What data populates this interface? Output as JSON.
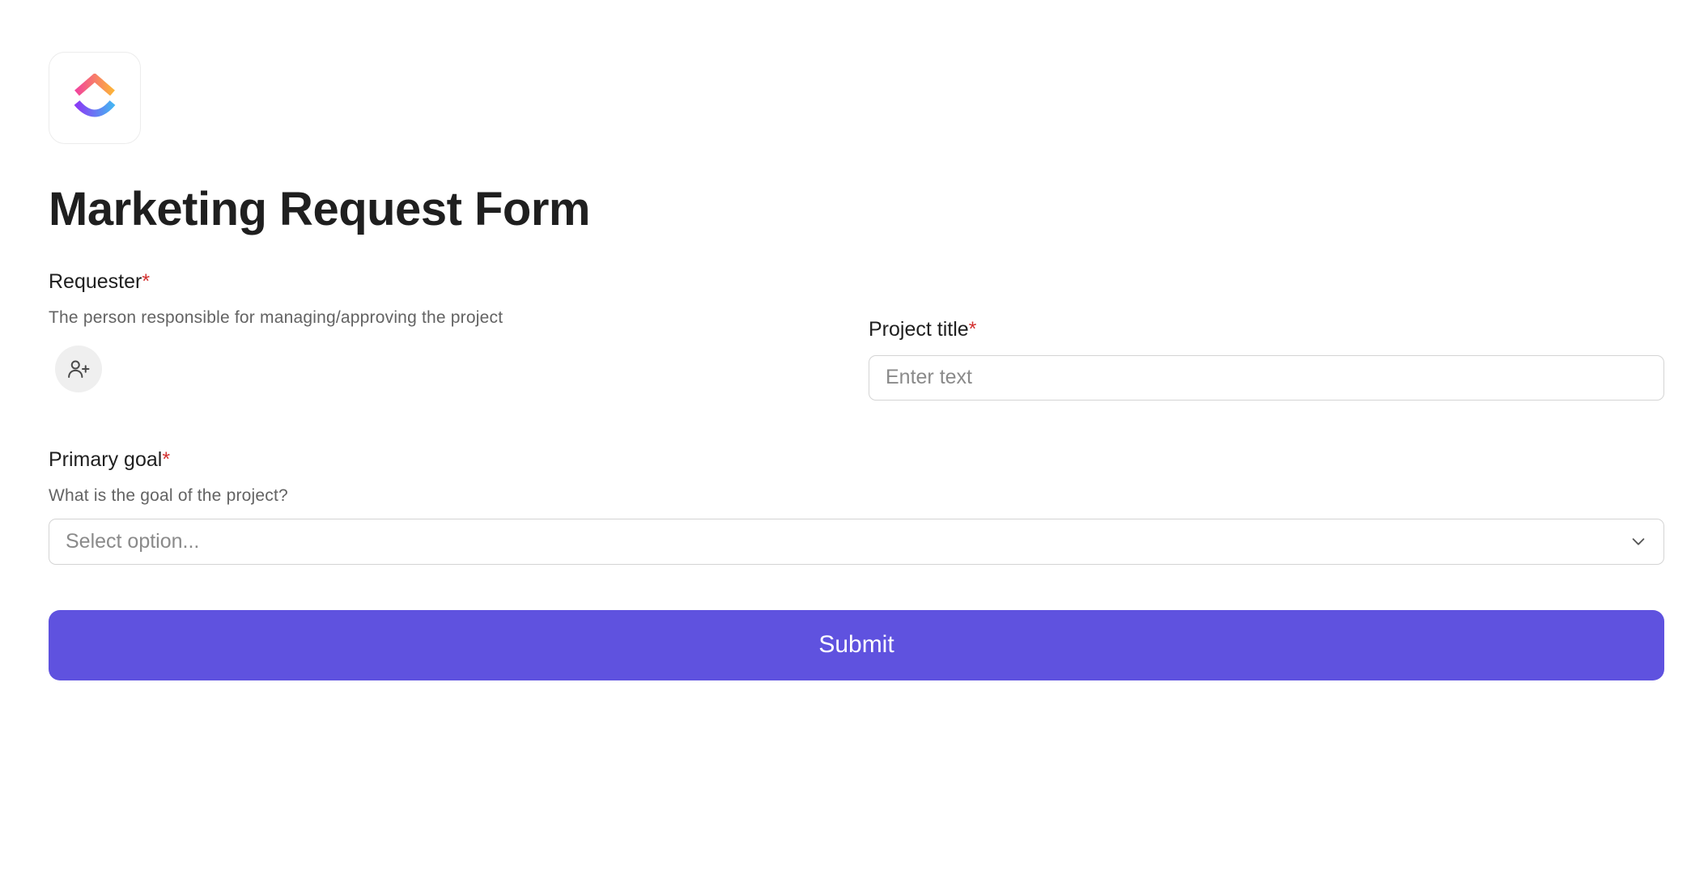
{
  "form": {
    "title": "Marketing Request Form",
    "logo_icon": "clickup-logo-icon",
    "required_marker": "*",
    "requester": {
      "label": "Requester",
      "help": "The person responsible for managing/approving the project",
      "assign_icon": "user-plus-icon"
    },
    "project_title": {
      "label": "Project title",
      "placeholder": "Enter text",
      "value": ""
    },
    "primary_goal": {
      "label": "Primary goal",
      "help": "What is the goal of the project?",
      "placeholder": "Select option...",
      "dropdown_icon": "chevron-down-icon"
    },
    "submit_label": "Submit"
  },
  "colors": {
    "accent": "#5f52df",
    "required": "#d3302f",
    "text": "#1f1f1f",
    "muted": "#636363",
    "border": "#d4d4d4"
  }
}
